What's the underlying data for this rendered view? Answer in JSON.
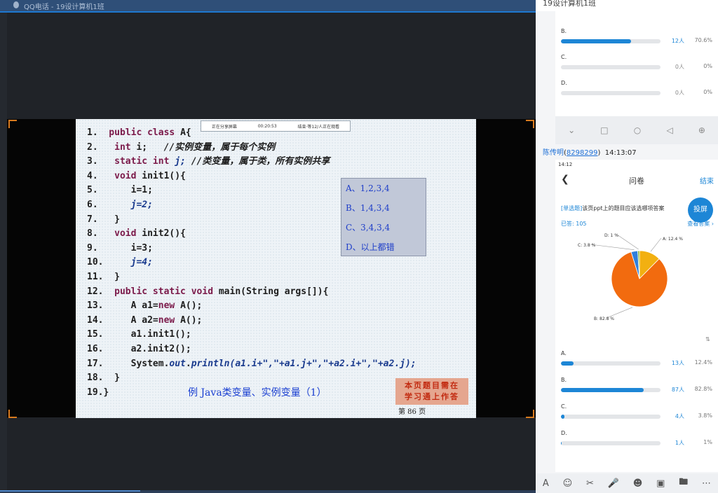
{
  "window": {
    "title": "QQ电话 - 19设计算机1班"
  },
  "share_bar": {
    "label": "正在分享屏幕",
    "time": "00:20:53",
    "watch": "结束·等12/人正在观看"
  },
  "slide": {
    "code": [
      {
        "num": "1.",
        "tokens": [
          {
            "t": " public class ",
            "c": "kw"
          },
          {
            "t": "A{",
            "c": "dark"
          }
        ]
      },
      {
        "num": "2.",
        "tokens": [
          {
            "t": "  int ",
            "c": "kw"
          },
          {
            "t": "i;",
            "c": "dark"
          },
          {
            "t": "   //实例变量，属于每个实例",
            "c": "cmt"
          }
        ]
      },
      {
        "num": "3.",
        "tokens": [
          {
            "t": "  static int ",
            "c": "kw"
          },
          {
            "t": "j;",
            "c": "ital"
          },
          {
            "t": " //类变量，属于类，所有实例共享",
            "c": "cmt"
          }
        ]
      },
      {
        "num": "4.",
        "tokens": [
          {
            "t": "  void ",
            "c": "kw"
          },
          {
            "t": "init1(){",
            "c": "dark"
          }
        ]
      },
      {
        "num": "5.",
        "tokens": [
          {
            "t": "     i=1;",
            "c": "dark"
          }
        ]
      },
      {
        "num": "6.",
        "tokens": [
          {
            "t": "     ",
            "c": "dark"
          },
          {
            "t": "j=2;",
            "c": "ital"
          }
        ]
      },
      {
        "num": "7.",
        "tokens": [
          {
            "t": "  }",
            "c": "dark"
          }
        ]
      },
      {
        "num": "8.",
        "tokens": [
          {
            "t": "  void ",
            "c": "kw"
          },
          {
            "t": "init2(){",
            "c": "dark"
          }
        ]
      },
      {
        "num": "9.",
        "tokens": [
          {
            "t": "     i=3;",
            "c": "dark"
          }
        ]
      },
      {
        "num": "10.",
        "tokens": [
          {
            "t": "     ",
            "c": "dark"
          },
          {
            "t": "j=4;",
            "c": "ital"
          }
        ]
      },
      {
        "num": "11.",
        "tokens": [
          {
            "t": "  }",
            "c": "dark"
          }
        ]
      },
      {
        "num": "12.",
        "tokens": [
          {
            "t": "  public static void ",
            "c": "kw"
          },
          {
            "t": "main(String args[]){",
            "c": "dark"
          }
        ]
      },
      {
        "num": "13.",
        "tokens": [
          {
            "t": "     A a1=",
            "c": "dark"
          },
          {
            "t": "new ",
            "c": "kw"
          },
          {
            "t": "A();",
            "c": "dark"
          }
        ]
      },
      {
        "num": "14.",
        "tokens": [
          {
            "t": "     A a2=",
            "c": "dark"
          },
          {
            "t": "new ",
            "c": "kw"
          },
          {
            "t": "A();",
            "c": "dark"
          }
        ]
      },
      {
        "num": "15.",
        "tokens": [
          {
            "t": "     a1.init1();",
            "c": "dark"
          }
        ]
      },
      {
        "num": "16.",
        "tokens": [
          {
            "t": "     a2.init2();",
            "c": "dark"
          }
        ]
      },
      {
        "num": "17.",
        "tokens": [
          {
            "t": "     System.",
            "c": "dark"
          },
          {
            "t": "out",
            "c": "ital"
          },
          {
            "t": ".",
            "c": "dark"
          },
          {
            "t": "println",
            "c": "ital"
          },
          {
            "t": "(a1.i+\",\"+a1.j+\",\"+a2.i+\",\"+a2.j);",
            "c": "ital"
          }
        ]
      },
      {
        "num": "18.",
        "tokens": [
          {
            "t": "  }",
            "c": "dark"
          }
        ]
      },
      {
        "num": "19.",
        "tokens": [
          {
            "t": "}",
            "c": "dark"
          }
        ]
      }
    ],
    "options": [
      "A、1,2,3,4",
      "B、1,4,3,4",
      "C、3,4,3,4",
      "D、以上都错"
    ],
    "caption": "例  Java类变量、实例变量（1）",
    "note_line1": "本页题目需在",
    "note_line2": "学习通上作答",
    "page_num": "第 86 页"
  },
  "right_panel": {
    "header": "19设计算机1班",
    "prev_results": [
      {
        "label": "B.",
        "count": "12人",
        "pct": "70.6%",
        "fraction": 0.706,
        "highlight": true
      },
      {
        "label": "C.",
        "count": "0人",
        "pct": "0%",
        "fraction": 0.0,
        "highlight": false
      },
      {
        "label": "D.",
        "count": "0人",
        "pct": "0%",
        "fraction": 0.0,
        "highlight": false
      }
    ],
    "nav_icons": [
      "chevron-down-icon",
      "square-icon",
      "circle-icon",
      "triangle-back-icon",
      "zoom-icon"
    ],
    "sender": {
      "name": "陈传明",
      "id": "8298299",
      "time": "14:13:07"
    },
    "phone": {
      "status_time": "14:12",
      "title": "问卷",
      "done": "结束",
      "question_type": "[单选题]",
      "question_text": "该页ppt上的题目应该选哪项答案",
      "answered": "已答: 105",
      "view_answer": "查看答案",
      "cast_button": "投屏",
      "sort_icon": "sort-icon"
    },
    "results": [
      {
        "label": "A.",
        "count": "13人",
        "pct": "12.4%",
        "fraction": 0.124
      },
      {
        "label": "B.",
        "count": "87人",
        "pct": "82.8%",
        "fraction": 0.828
      },
      {
        "label": "C.",
        "count": "4人",
        "pct": "3.8%",
        "fraction": 0.038
      },
      {
        "label": "D.",
        "count": "1人",
        "pct": "1%",
        "fraction": 0.01
      }
    ],
    "toolbar_icons": [
      "text-format-icon",
      "emoji-icon",
      "scissors-icon",
      "microphone-icon",
      "sticker-icon",
      "image-icon",
      "folder-icon",
      "more-icon"
    ]
  },
  "chart_data": {
    "type": "pie",
    "categories": [
      "A",
      "B",
      "C",
      "D"
    ],
    "values": [
      12.4,
      82.8,
      3.8,
      1
    ],
    "labels": [
      "A: 12.4 %",
      "B: 82.8 %",
      "C: 3.8 %",
      "D: 1 %"
    ],
    "colors": [
      "#f2b011",
      "#f26b0f",
      "#2f7fdc",
      "#7fb539"
    ]
  }
}
